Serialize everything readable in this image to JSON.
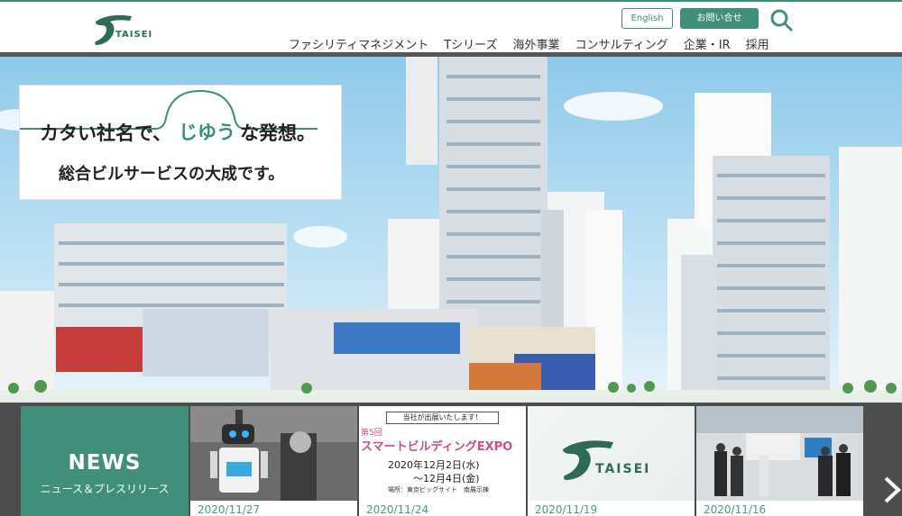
{
  "header": {
    "logo_alt": "TAISEI",
    "english_label": "English",
    "contact_label": "お問い合せ",
    "nav": [
      "ファシリティマネジメント",
      "Tシリーズ",
      "海外事業",
      "コンサルティング",
      "企業・IR",
      "採用"
    ]
  },
  "hero": {
    "catch_line1_a": "カタい社名で、",
    "catch_line1_highlight": "じゆう",
    "catch_line1_b": "な発想。",
    "catch_line2": "総合ビルサービスの大成です。"
  },
  "news": {
    "title": "NEWS",
    "subtitle": "ニュース＆プレスリリース",
    "items": [
      {
        "date": "2020/11/27"
      },
      {
        "date": "2020/11/24",
        "banner": "当社が出展いたします！",
        "expo_prefix": "第5回",
        "expo_title": "スマートビルディングEXPO",
        "expo_date1": "2020年12月2日(水)",
        "expo_date2": "〜12月4日(金)",
        "expo_place": "場所：東京ビッグサイト　南展示棟"
      },
      {
        "date": "2020/11/19",
        "logo_text": "TAISEI"
      },
      {
        "date": "2020/11/16"
      }
    ]
  },
  "colors": {
    "brand_green": "#3f8f7a",
    "dark_strip": "#4d4d4d",
    "sky": "#8ec9ea"
  }
}
